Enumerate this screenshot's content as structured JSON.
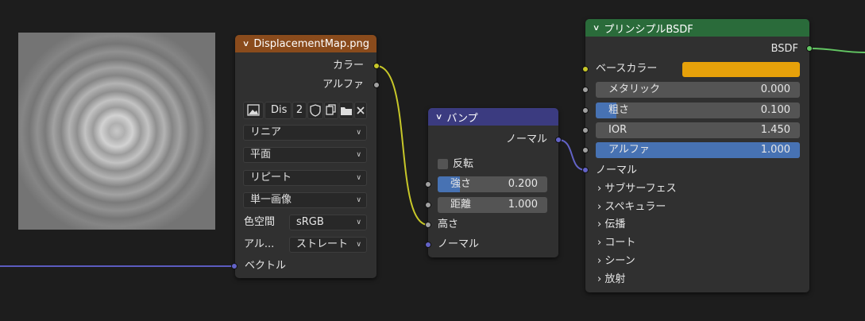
{
  "image_node": {
    "title": "DisplacementMap.png",
    "header_color": "#8a4b1c",
    "outputs": {
      "color": "カラー",
      "alpha": "アルファ"
    },
    "image_name": "Dis",
    "users": "2",
    "interpolation": "リニア",
    "projection": "平面",
    "extension": "リピート",
    "source": "単一画像",
    "colorspace_label": "色空間",
    "colorspace_value": "sRGB",
    "alpha_label": "アル...",
    "alpha_value": "ストレート",
    "input_vector": "ベクトル"
  },
  "bump_node": {
    "title": "バンプ",
    "header_color": "#3b3b80",
    "output_normal": "ノーマル",
    "invert_label": "反転",
    "strength": {
      "label": "強さ",
      "value": "0.200",
      "fraction": 0.2
    },
    "distance": {
      "label": "距離",
      "value": "1.000"
    },
    "input_height": "高さ",
    "input_normal": "ノーマル"
  },
  "bsdf_node": {
    "title": "プリンシプルBSDF",
    "header_color": "#2a6b3a",
    "output_bsdf": "BSDF",
    "base_color_label": "ベースカラー",
    "base_color": "#e6a10a",
    "metallic": {
      "label": "メタリック",
      "value": "0.000"
    },
    "roughness": {
      "label": "粗さ",
      "value": "0.100",
      "fraction": 0.1
    },
    "ior": {
      "label": "IOR",
      "value": "1.450"
    },
    "alpha": {
      "label": "アルファ",
      "value": "1.000",
      "fraction": 1.0
    },
    "normal": "ノーマル",
    "panels": [
      "サブサーフェス",
      "スペキュラー",
      "伝播",
      "コート",
      "シーン",
      "放射"
    ]
  },
  "colors": {
    "link_yellow": "#c7c729",
    "link_gray": "#a1a1a1",
    "link_blue": "#6363c7",
    "link_green": "#63c763",
    "accent_blue": "#4772b3"
  }
}
